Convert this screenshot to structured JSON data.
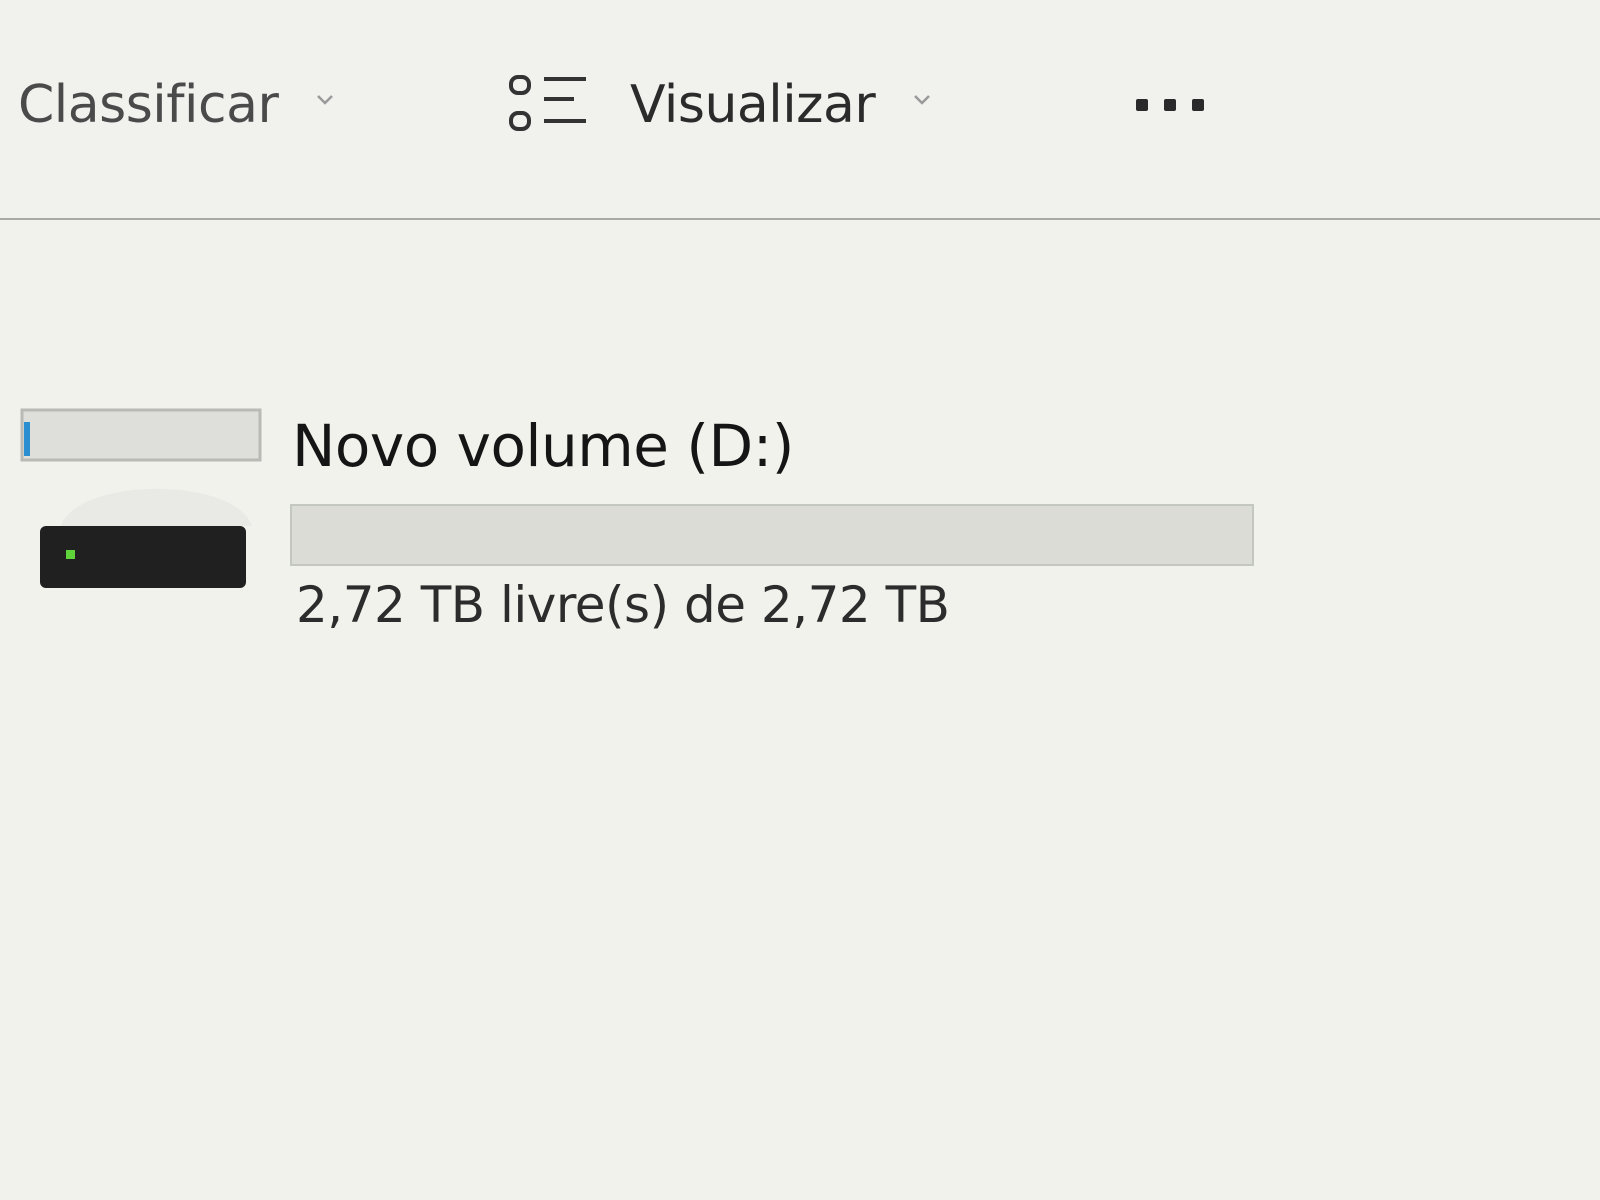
{
  "toolbar": {
    "sort_label": "Classificar",
    "sort_icon": "chevron-down-icon",
    "view_label": "Visualizar",
    "view_icon": "view-options-icon",
    "more_icon": "more-ellipsis-icon"
  },
  "drive": {
    "name": "Novo volume (D:)",
    "space_text": "2,72 TB livre(s) de 2,72 TB",
    "used_fraction": 0,
    "icon": "hard-drive-icon",
    "led_color": "#5fd43a"
  }
}
